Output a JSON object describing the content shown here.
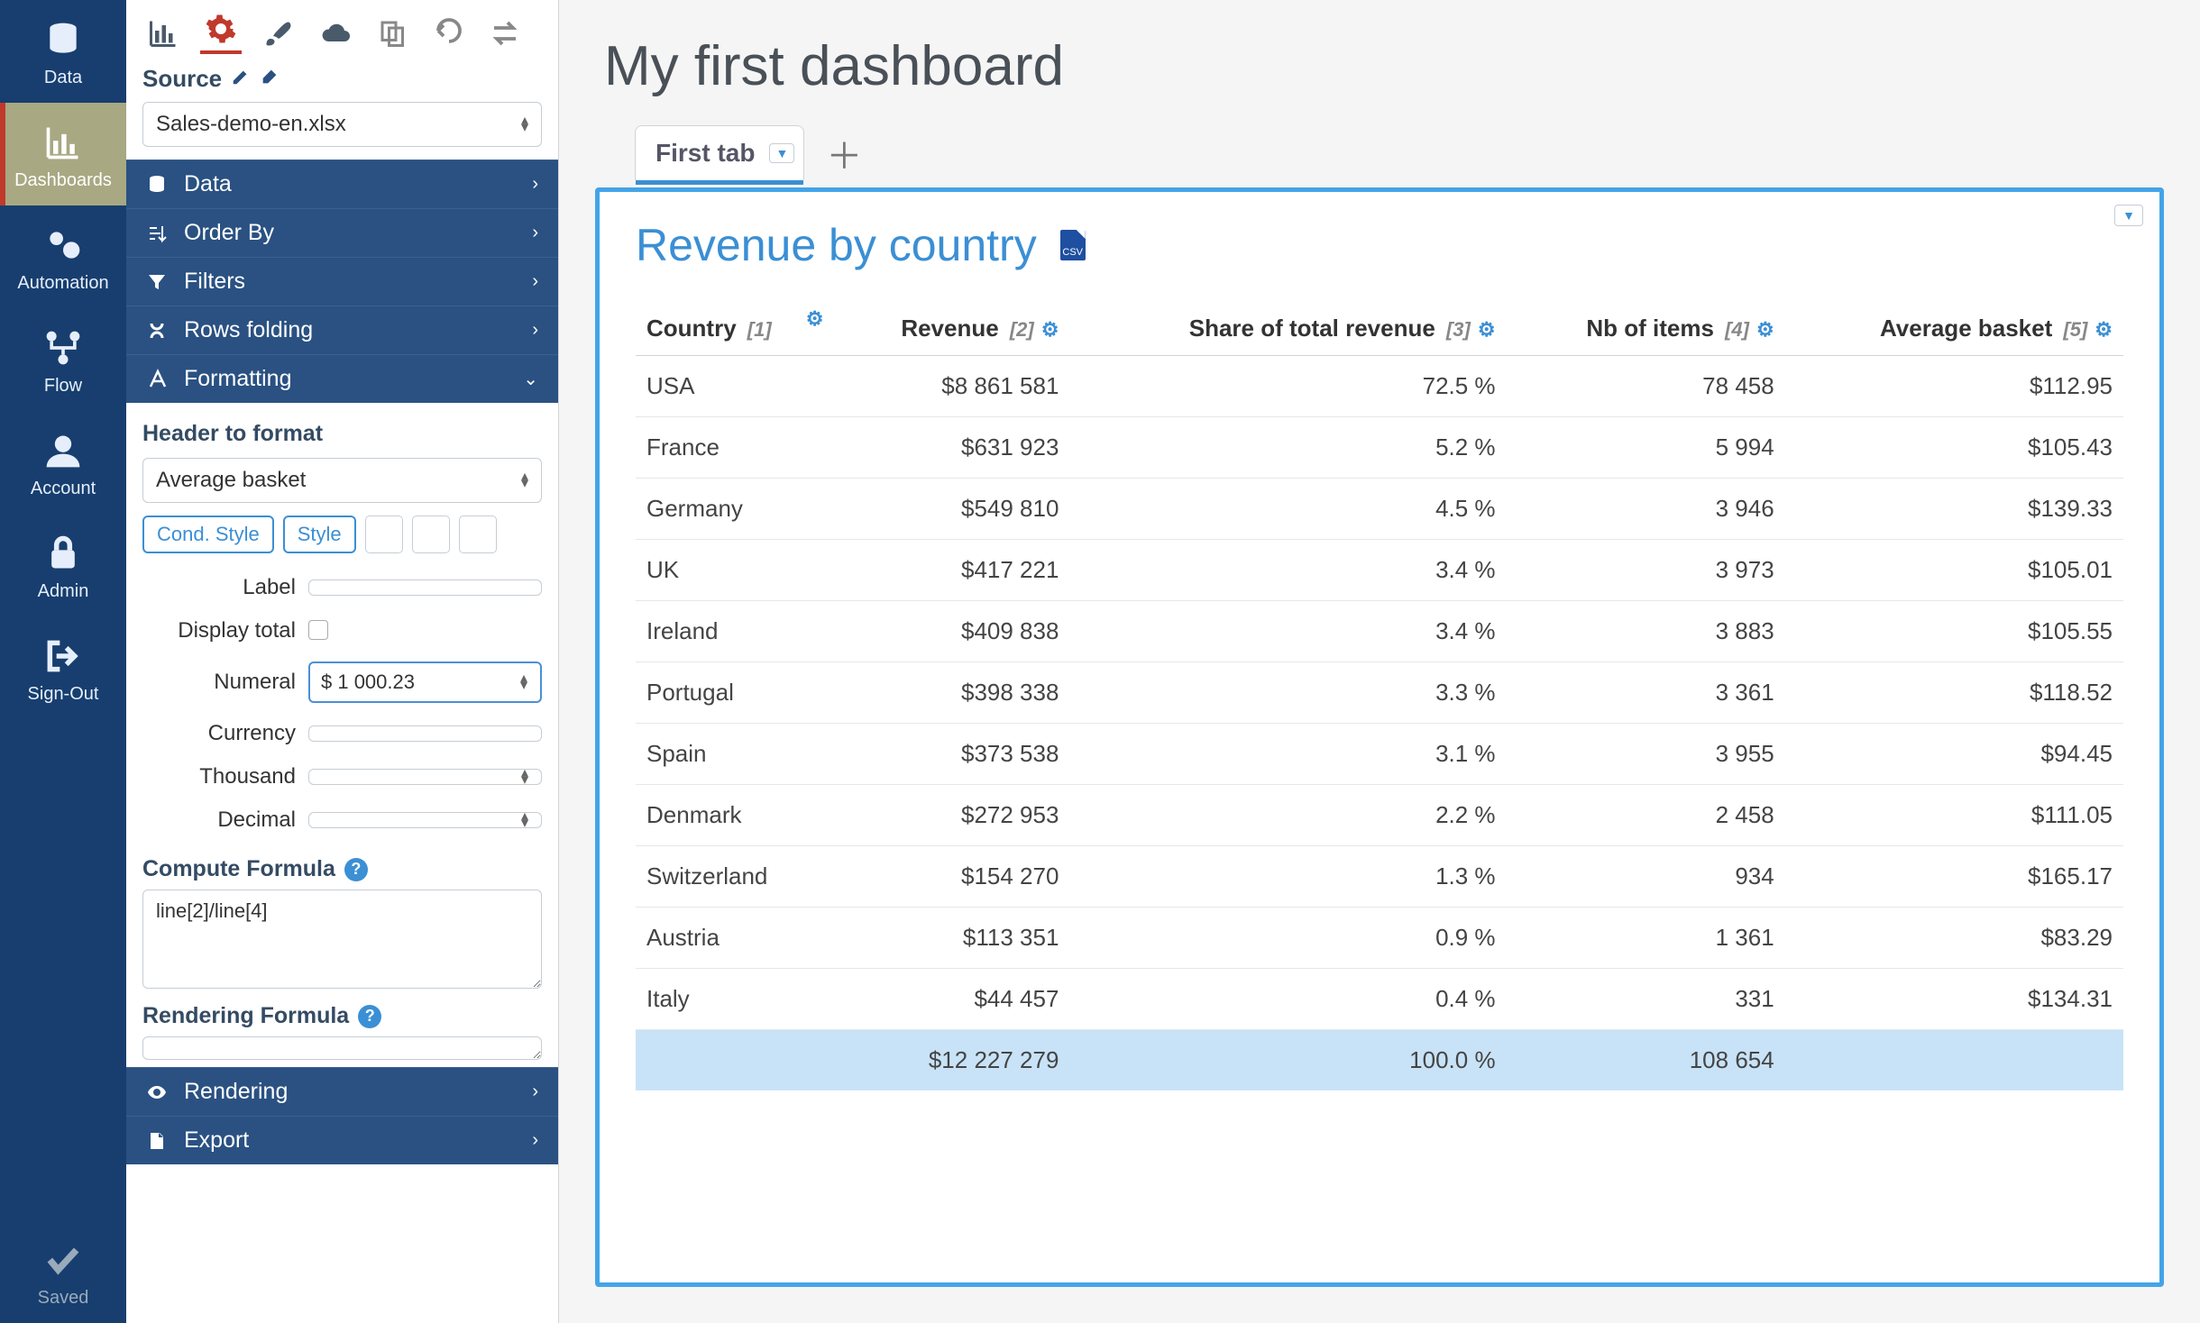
{
  "nav": {
    "items": [
      {
        "label": "Data"
      },
      {
        "label": "Dashboards"
      },
      {
        "label": "Automation"
      },
      {
        "label": "Flow"
      },
      {
        "label": "Account"
      },
      {
        "label": "Admin"
      },
      {
        "label": "Sign-Out"
      }
    ],
    "saved_label": "Saved"
  },
  "config": {
    "source_label": "Source",
    "source_value": "Sales-demo-en.xlsx",
    "accordion": {
      "data": "Data",
      "order": "Order By",
      "filters": "Filters",
      "rows": "Rows folding",
      "formatting": "Formatting",
      "rendering": "Rendering",
      "export": "Export"
    },
    "formatting": {
      "header_to_format_label": "Header to format",
      "header_to_format_value": "Average basket",
      "cond_style_btn": "Cond. Style",
      "style_btn": "Style",
      "label_lbl": "Label",
      "label_val": "",
      "display_total_lbl": "Display total",
      "numeral_lbl": "Numeral",
      "numeral_val": "$ 1 000.23",
      "currency_lbl": "Currency",
      "currency_val": "",
      "thousand_lbl": "Thousand",
      "thousand_val": "",
      "decimal_lbl": "Decimal",
      "decimal_val": "",
      "compute_formula_lbl": "Compute Formula",
      "compute_formula_val": "line[2]/line[4]",
      "rendering_formula_lbl": "Rendering Formula",
      "rendering_formula_val": ""
    }
  },
  "dashboard": {
    "title": "My first dashboard",
    "tab_label": "First tab",
    "widget_title": "Revenue by country",
    "csv_label": "CSV"
  },
  "chart_data": {
    "type": "table",
    "columns": [
      {
        "name": "Country",
        "index": "[1]",
        "align": "left"
      },
      {
        "name": "Revenue",
        "index": "[2]",
        "align": "right"
      },
      {
        "name": "Share of total revenue",
        "index": "[3]",
        "align": "right"
      },
      {
        "name": "Nb of items",
        "index": "[4]",
        "align": "right"
      },
      {
        "name": "Average basket",
        "index": "[5]",
        "align": "right"
      }
    ],
    "rows": [
      [
        "USA",
        "$8 861 581",
        "72.5 %",
        "78 458",
        "$112.95"
      ],
      [
        "France",
        "$631 923",
        "5.2 %",
        "5 994",
        "$105.43"
      ],
      [
        "Germany",
        "$549 810",
        "4.5 %",
        "3 946",
        "$139.33"
      ],
      [
        "UK",
        "$417 221",
        "3.4 %",
        "3 973",
        "$105.01"
      ],
      [
        "Ireland",
        "$409 838",
        "3.4 %",
        "3 883",
        "$105.55"
      ],
      [
        "Portugal",
        "$398 338",
        "3.3 %",
        "3 361",
        "$118.52"
      ],
      [
        "Spain",
        "$373 538",
        "3.1 %",
        "3 955",
        "$94.45"
      ],
      [
        "Denmark",
        "$272 953",
        "2.2 %",
        "2 458",
        "$111.05"
      ],
      [
        "Switzerland",
        "$154 270",
        "1.3 %",
        "934",
        "$165.17"
      ],
      [
        "Austria",
        "$113 351",
        "0.9 %",
        "1 361",
        "$83.29"
      ],
      [
        "Italy",
        "$44 457",
        "0.4 %",
        "331",
        "$134.31"
      ]
    ],
    "totals": [
      "",
      "$12 227 279",
      "100.0 %",
      "108 654",
      ""
    ]
  }
}
